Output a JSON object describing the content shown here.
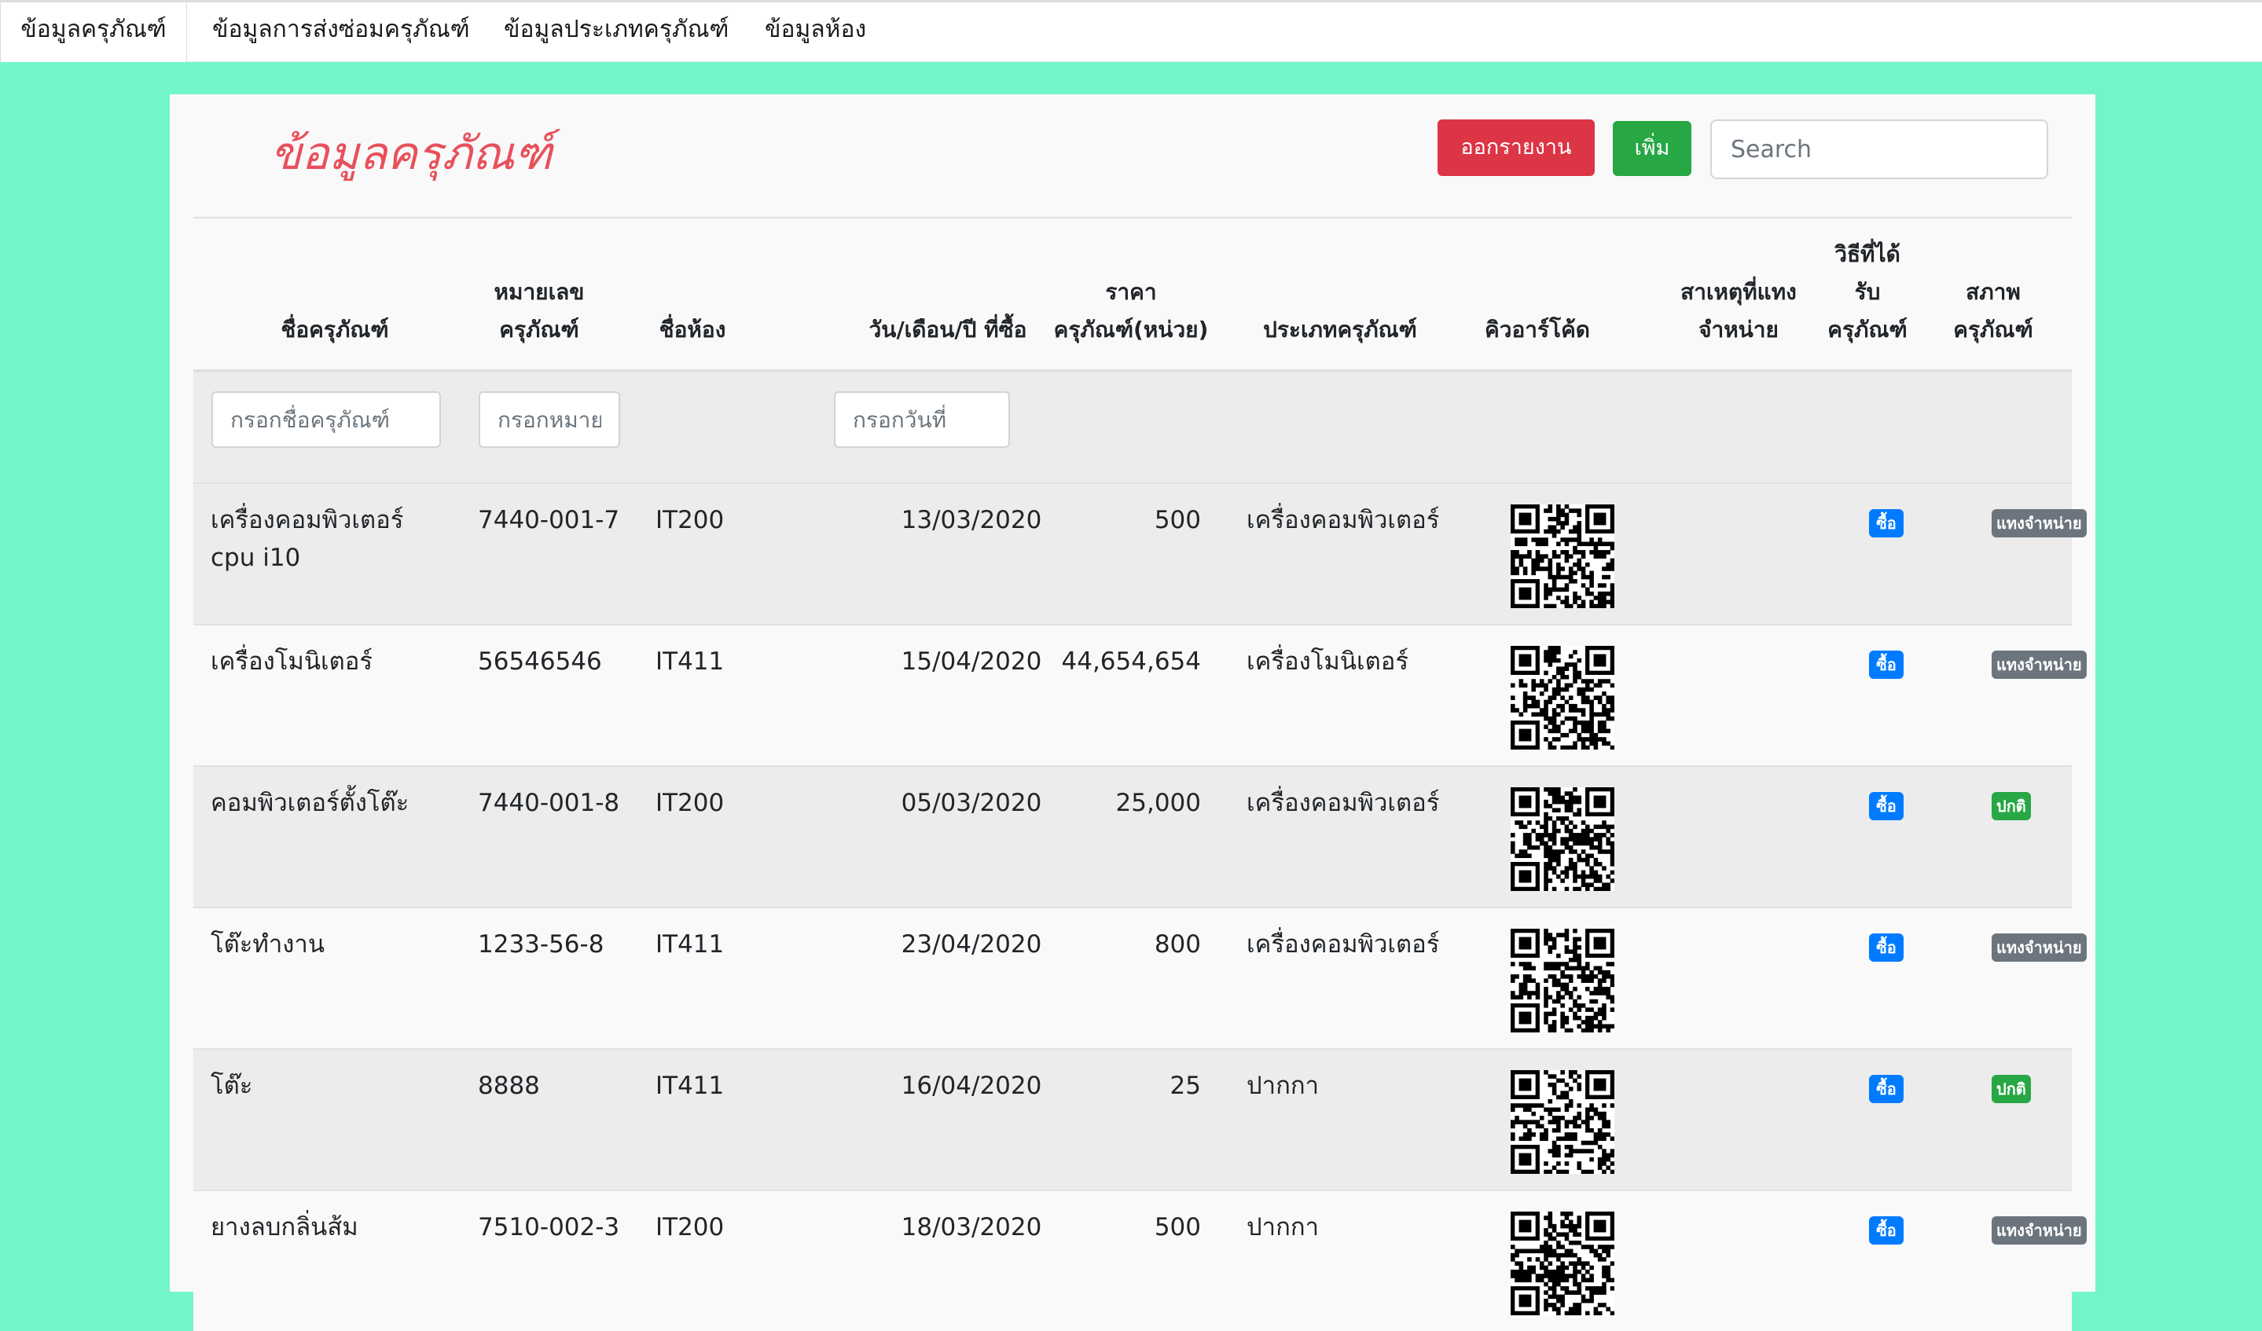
{
  "nav": {
    "tabs": [
      {
        "label": "ข้อมูลครุภัณฑ์",
        "active": true
      },
      {
        "label": "ข้อมูลการส่งซ่อมครุภัณฑ์",
        "active": false
      },
      {
        "label": "ข้อมูลประเภทครุภัณฑ์",
        "active": false
      },
      {
        "label": "ข้อมูลห้อง",
        "active": false
      }
    ]
  },
  "page": {
    "title": "ข้อมูลครุภัณฑ์",
    "report_button": "ออกรายงาน",
    "add_button": "เพิ่ม",
    "search_placeholder": "Search"
  },
  "table": {
    "headers": {
      "name": "ชื่อครุภัณฑ์",
      "number_line1": "หมายเลข",
      "number_line2": "ครุภัณฑ์",
      "room": "ชื่อห้อง",
      "date": "วัน/เดือน/ปี ที่ซื้อ",
      "price_line1": "ราคา",
      "price_line2": "ครุภัณฑ์(หน่วย)",
      "type": "ประเภทครุภัณฑ์",
      "qr": "คิวอาร์โค้ด",
      "reason_line1": "สาเหตุที่แทง",
      "reason_line2": "จำหน่าย",
      "method_line1": "วิธีที่ได้",
      "method_line2": "รับ",
      "method_line3": "ครุภัณฑ์",
      "status_line1": "สภาพ",
      "status_line2": "ครุภัณฑ์"
    },
    "filters": {
      "name_placeholder": "กรอกชื่อครุภัณฑ์",
      "number_placeholder": "กรอกหมาย",
      "date_placeholder": "กรอกวันที่"
    },
    "rows": [
      {
        "name": "เครื่องคอมพิวเตอร์ cpu i10",
        "number": "7440-001-7",
        "room": "IT200",
        "date": "13/03/2020",
        "price": "500",
        "type": "เครื่องคอมพิวเตอร์",
        "reason": "",
        "method": "ซื้อ",
        "status": "แทงจำหน่าย",
        "status_color": "#6c757d"
      },
      {
        "name": "เครื่องโมนิเตอร์",
        "number": "56546546",
        "room": "IT411",
        "date": "15/04/2020",
        "price": "44,654,654",
        "type": "เครื่องโมนิเตอร์",
        "reason": "",
        "method": "ซื้อ",
        "status": "แทงจำหน่าย",
        "status_color": "#6c757d"
      },
      {
        "name": "คอมพิวเตอร์ตั้งโต๊ะ",
        "number": "7440-001-8",
        "room": "IT200",
        "date": "05/03/2020",
        "price": "25,000",
        "type": "เครื่องคอมพิวเตอร์",
        "reason": "",
        "method": "ซื้อ",
        "status": "ปกติ",
        "status_color": "#28a745"
      },
      {
        "name": "โต๊ะทำงาน",
        "number": "1233-56-8",
        "room": "IT411",
        "date": "23/04/2020",
        "price": "800",
        "type": "เครื่องคอมพิวเตอร์",
        "reason": "",
        "method": "ซื้อ",
        "status": "แทงจำหน่าย",
        "status_color": "#6c757d"
      },
      {
        "name": "โต๊ะ",
        "number": "8888",
        "room": "IT411",
        "date": "16/04/2020",
        "price": "25",
        "type": "ปากกา",
        "reason": "",
        "method": "ซื้อ",
        "status": "ปกติ",
        "status_color": "#28a745"
      },
      {
        "name": "ยางลบกลิ่นส้ม",
        "number": "7510-002-3",
        "room": "IT200",
        "date": "18/03/2020",
        "price": "500",
        "type": "ปากกา",
        "reason": "",
        "method": "ซื้อ",
        "status": "แทงจำหน่าย",
        "status_color": "#6c757d"
      }
    ]
  },
  "colors": {
    "background": "#73f5cc",
    "title": "#e8505b",
    "report_button": "#dc3545",
    "add_button": "#28a745",
    "method_badge": "#007bff"
  }
}
